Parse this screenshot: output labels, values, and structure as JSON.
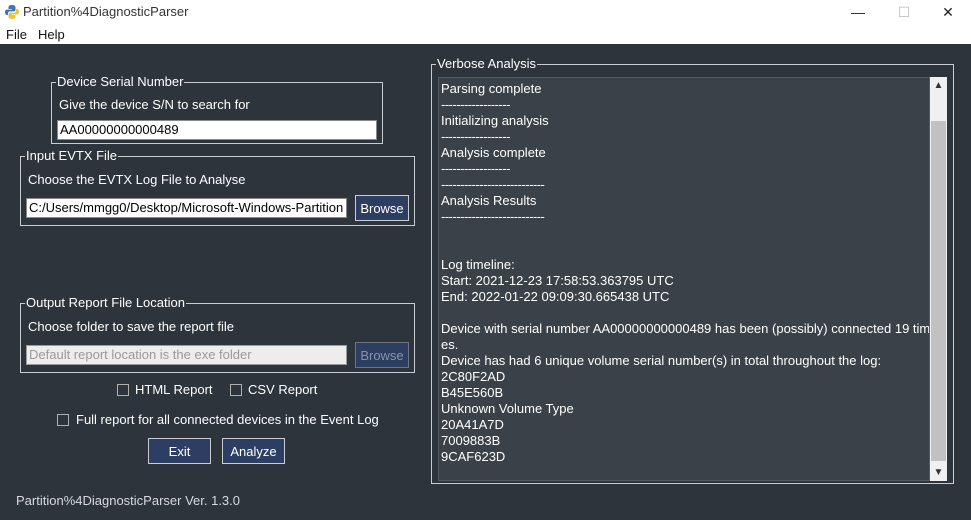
{
  "window": {
    "title": "Partition%4DiagnosticParser",
    "minimize": "—",
    "maximize": "☐",
    "close": "✕"
  },
  "menu": {
    "file": "File",
    "help": "Help"
  },
  "device": {
    "group_title": "Device Serial Number",
    "prompt": "Give the device S/N to search for",
    "value": "AA00000000000489"
  },
  "evtx": {
    "group_title": "Input EVTX File",
    "prompt": "Choose the EVTX Log File to Analyse",
    "path": "C:/Users/mmgg0/Desktop/Microsoft-Windows-Partition",
    "browse": "Browse"
  },
  "output": {
    "group_title": "Output Report File Location",
    "prompt": "Choose folder to save the report file",
    "placeholder": "Default report location is the exe folder",
    "browse": "Browse"
  },
  "options": {
    "html": "HTML Report",
    "csv": "CSV Report",
    "full": "Full report for all connected devices in the Event Log"
  },
  "buttons": {
    "exit": "Exit",
    "analyze": "Analyze"
  },
  "version": "Partition%4DiagnosticParser Ver. 1.3.0",
  "verbose": {
    "title": "Verbose Analysis",
    "lines": [
      "Parsing complete",
      "------------------",
      "Initializing analysis",
      "------------------",
      "Analysis complete",
      "------------------",
      "---------------------------",
      "Analysis Results",
      "---------------------------",
      "",
      "",
      "Log timeline:",
      "Start: 2021-12-23 17:58:53.363795 UTC",
      "End: 2022-01-22 09:09:30.665438 UTC",
      "",
      "Device with serial number AA00000000000489 has been (possibly) connected 19 tim",
      "es.",
      "Device has had 6 unique volume serial number(s) in total throughout the log:",
      "2C80F2AD",
      "B45E560B",
      "Unknown Volume Type",
      "20A41A7D",
      "7009883B",
      "9CAF623D"
    ]
  },
  "scrollbar": {
    "up": "▲",
    "down": "▼"
  },
  "colors": {
    "background": "#2d343b",
    "button": "#2c3e62",
    "log_background": "#3b4148"
  }
}
